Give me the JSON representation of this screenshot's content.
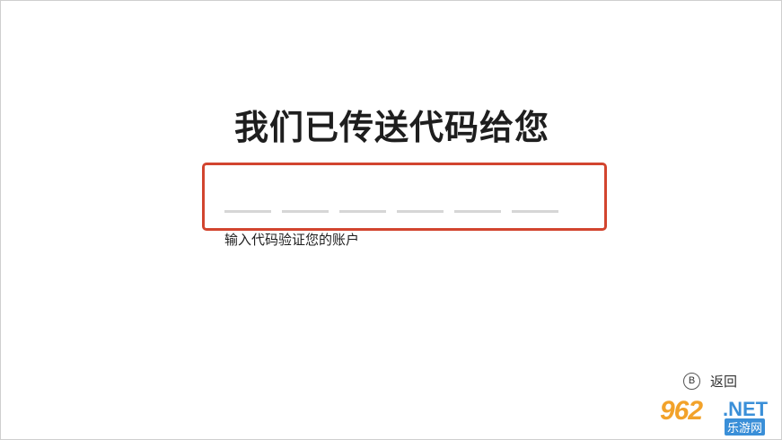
{
  "heading": "我们已传送代码给您",
  "code_input": {
    "slots": [
      "",
      "",
      "",
      "",
      "",
      ""
    ],
    "hint": "输入代码验证您的账户"
  },
  "back": {
    "button_glyph": "B",
    "label": "返回"
  },
  "watermark": {
    "main": "962",
    "domain": ".NET",
    "sub": "乐游网"
  },
  "colors": {
    "accent_border": "#d2452f",
    "slot_line": "#d6d6d6",
    "text": "#1e1e1e"
  }
}
